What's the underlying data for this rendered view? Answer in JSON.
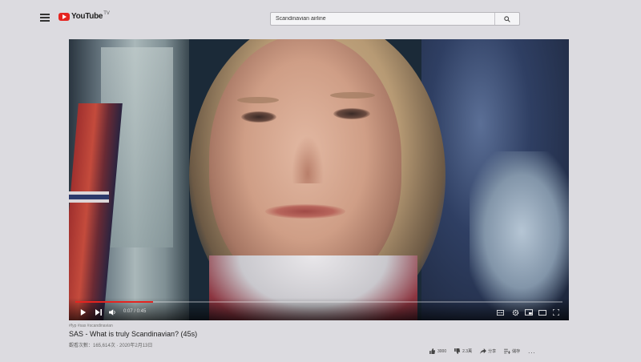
{
  "header": {
    "logo_text": "YouTube",
    "logo_suffix": "TV",
    "search_value": "Scandinavian airline"
  },
  "player": {
    "time": "0:07 / 0:45",
    "progress_fraction": 0.16
  },
  "video": {
    "tags": "#fyp #sas #scandinavian",
    "title": "SAS - What is truly Scandinavian? (45s)",
    "sub": "觀看次數：165,614次 · 2020年2月13日"
  },
  "actions": {
    "like": "3000",
    "dislike": "2.3萬",
    "share": "分享",
    "save": "儲存",
    "more": "..."
  }
}
